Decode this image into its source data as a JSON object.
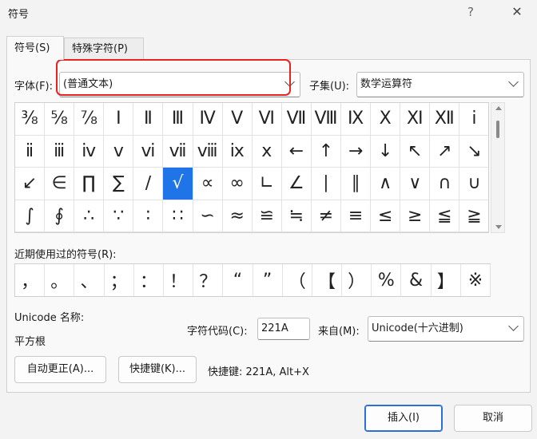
{
  "window": {
    "title": "符号",
    "help_icon": "?",
    "close_icon": "✕"
  },
  "tabs": [
    {
      "label": "符号(S)"
    },
    {
      "label": "特殊字符(P)"
    }
  ],
  "font": {
    "label": "字体(F):",
    "value": "(普通文本)"
  },
  "subset": {
    "label": "子集(U):",
    "value": "数学运算符"
  },
  "symbols": [
    "⅜",
    "⅝",
    "⅞",
    "Ⅰ",
    "Ⅱ",
    "Ⅲ",
    "Ⅳ",
    "Ⅴ",
    "Ⅵ",
    "Ⅶ",
    "Ⅷ",
    "Ⅸ",
    "Ⅹ",
    "Ⅺ",
    "Ⅻ",
    "ⅰ",
    "ⅱ",
    "ⅲ",
    "ⅳ",
    "ⅴ",
    "ⅵ",
    "ⅶ",
    "ⅷ",
    "ⅸ",
    "ⅹ",
    "←",
    "↑",
    "→",
    "↓",
    "↖",
    "↗",
    "↘",
    "↙",
    "∈",
    "∏",
    "∑",
    "∕",
    "√",
    "∝",
    "∞",
    "∟",
    "∠",
    "∣",
    "∥",
    "∧",
    "∨",
    "∩",
    "∪",
    "∫",
    "∮",
    "∴",
    "∵",
    "∶",
    "∷",
    "∽",
    "≈",
    "≌",
    "≒",
    "≠",
    "≡",
    "≤",
    "≥",
    "≦",
    "≧"
  ],
  "selected_symbol": "√",
  "recent": {
    "label": "近期使用过的符号(R):",
    "items": [
      "，",
      "。",
      "、",
      "；",
      "：",
      "！",
      "？",
      "“",
      "”",
      "（",
      "【",
      "）",
      "%",
      "&",
      "】",
      "※"
    ]
  },
  "unicode_name": {
    "label": "Unicode 名称:",
    "value": "平方根"
  },
  "char_code": {
    "label": "字符代码(C):",
    "value": "221A"
  },
  "from": {
    "label": "来自(M):",
    "value": "Unicode(十六进制)"
  },
  "buttons": {
    "autocorrect": "自动更正(A)...",
    "shortcut_key": "快捷键(K)...",
    "shortcut_info": "快捷键: 221A, Alt+X",
    "insert": "插入(I)",
    "cancel": "取消"
  },
  "colors": {
    "selection": "#1f74e8",
    "highlight_box": "#e8231f"
  }
}
